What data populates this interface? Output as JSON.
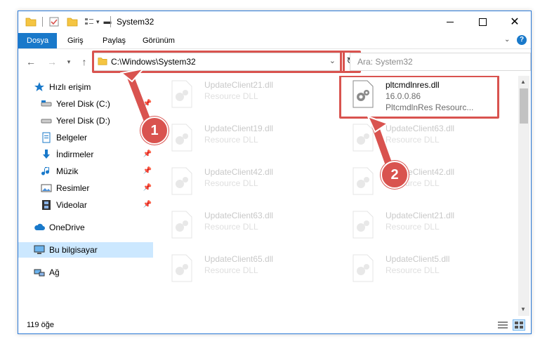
{
  "window": {
    "title": "System32"
  },
  "ribbon": {
    "tabs": [
      "Dosya",
      "Giriş",
      "Paylaş",
      "Görünüm"
    ]
  },
  "address": {
    "path": "C:\\Windows\\System32"
  },
  "search": {
    "placeholder": "Ara: System32"
  },
  "nav": {
    "quick_access": "Hızlı erişim",
    "items": [
      {
        "label": "Yerel Disk (C:)",
        "pinned": true
      },
      {
        "label": "Yerel Disk (D:)",
        "pinned": false
      },
      {
        "label": "Belgeler",
        "pinned": true
      },
      {
        "label": "İndirmeler",
        "pinned": true
      },
      {
        "label": "Müzik",
        "pinned": true
      },
      {
        "label": "Resimler",
        "pinned": true
      },
      {
        "label": "Videolar",
        "pinned": true
      }
    ],
    "onedrive": "OneDrive",
    "this_pc": "Bu bilgisayar",
    "network": "Ağ"
  },
  "files": [
    {
      "name": "UpdateClient21.dll",
      "desc": "Resource DLL",
      "faded": true
    },
    {
      "name": "pltcmdlnres.dll",
      "version": "16.0.0.86",
      "desc": "PltcmdlnRes Resourc...",
      "faded": false
    },
    {
      "name": "UpdateClient19.dll",
      "desc": "Resource DLL",
      "faded": true
    },
    {
      "name": "UpdateClient63.dll",
      "desc": "Resource DLL",
      "faded": true
    },
    {
      "name": "UpdateClient42.dll",
      "desc": "Resource DLL",
      "faded": true
    },
    {
      "name": "UpdateClient42.dll",
      "desc": "Resource DLL",
      "faded": true
    },
    {
      "name": "UpdateClient63.dll",
      "desc": "Resource DLL",
      "faded": true
    },
    {
      "name": "UpdateClient21.dll",
      "desc": "Resource DLL",
      "faded": true
    },
    {
      "name": "UpdateClient65.dll",
      "desc": "Resource DLL",
      "faded": true
    },
    {
      "name": "UpdateClient5.dll",
      "desc": "Resource DLL",
      "faded": true
    }
  ],
  "status": {
    "count": "119 öğe"
  },
  "annotations": {
    "step1": "1",
    "step2": "2"
  },
  "colors": {
    "accent": "#1979ca",
    "highlight": "#d9534f",
    "selected": "#cce8ff"
  }
}
